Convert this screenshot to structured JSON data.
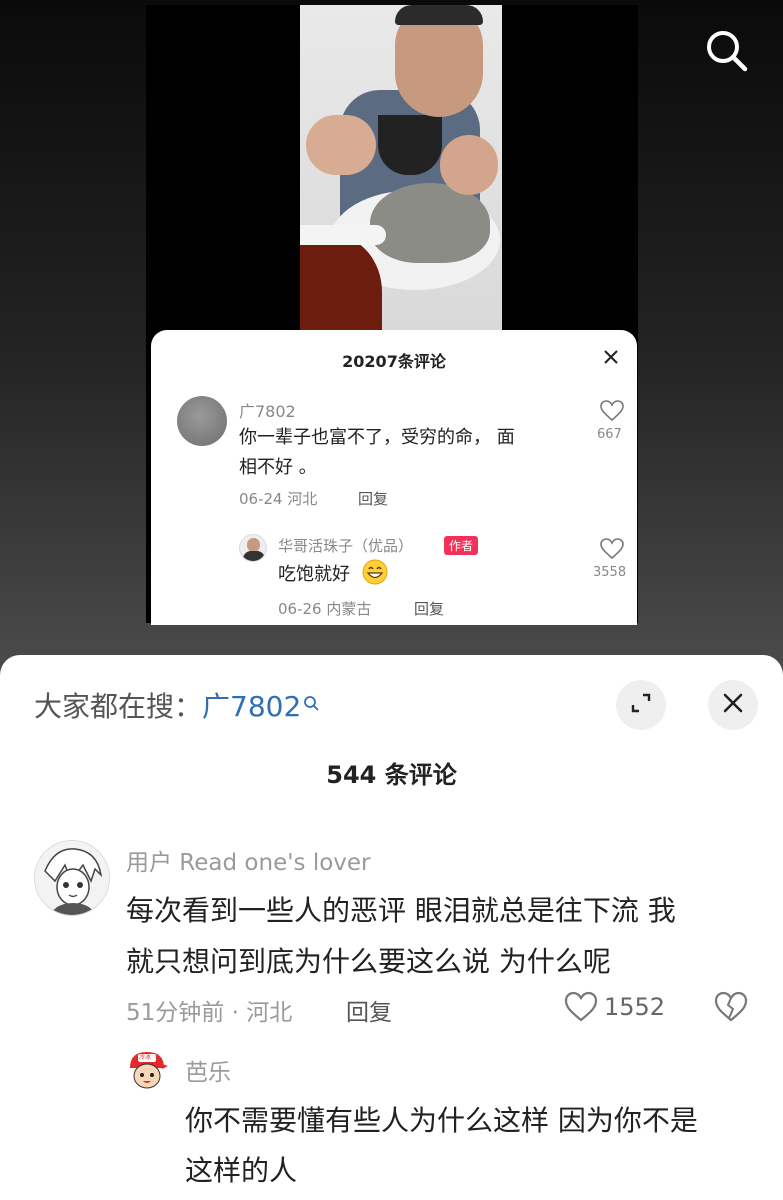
{
  "video_comments": {
    "count_title": "20207条评论",
    "comment": {
      "username": "广7802",
      "text_line1": "你一辈子也富不了，受穷的命， 面",
      "text_line2": "相不好 。",
      "meta": "06-24 河北",
      "reply_label": "回复",
      "likes": "667"
    },
    "reply": {
      "username": "华哥活珠子（优品）",
      "badge": "作者",
      "text": "吃饱就好",
      "meta": "06-26 内蒙古",
      "reply_label": "回复",
      "likes": "3558"
    }
  },
  "sheet": {
    "search_prefix": "大家都在搜：",
    "search_keyword": "广7802",
    "title": "544 条评论",
    "comment": {
      "username": "用户 Read one's lover",
      "text_line1": "每次看到一些人的恶评 眼泪就总是往下流 我",
      "text_line2": "就只想问到底为什么要这么说 为什么呢",
      "meta": "51分钟前 · 河北",
      "reply_label": "回复",
      "likes": "1552"
    },
    "reply": {
      "username": "芭乐",
      "text_line1": "你不需要懂有些人为什么这样 因为你不是",
      "text_line2": "这样的人",
      "avatar_badge": "冷冰"
    }
  },
  "colors": {
    "author_badge": "#f2315a",
    "link_blue": "#2f6fb3",
    "text_dark": "#222222",
    "text_gray": "#8a8a8a"
  },
  "icons": [
    "search-icon",
    "close-icon",
    "heart-icon",
    "expand-icon",
    "broken-heart-icon",
    "search-mini-icon",
    "laugh-emoji-icon"
  ]
}
